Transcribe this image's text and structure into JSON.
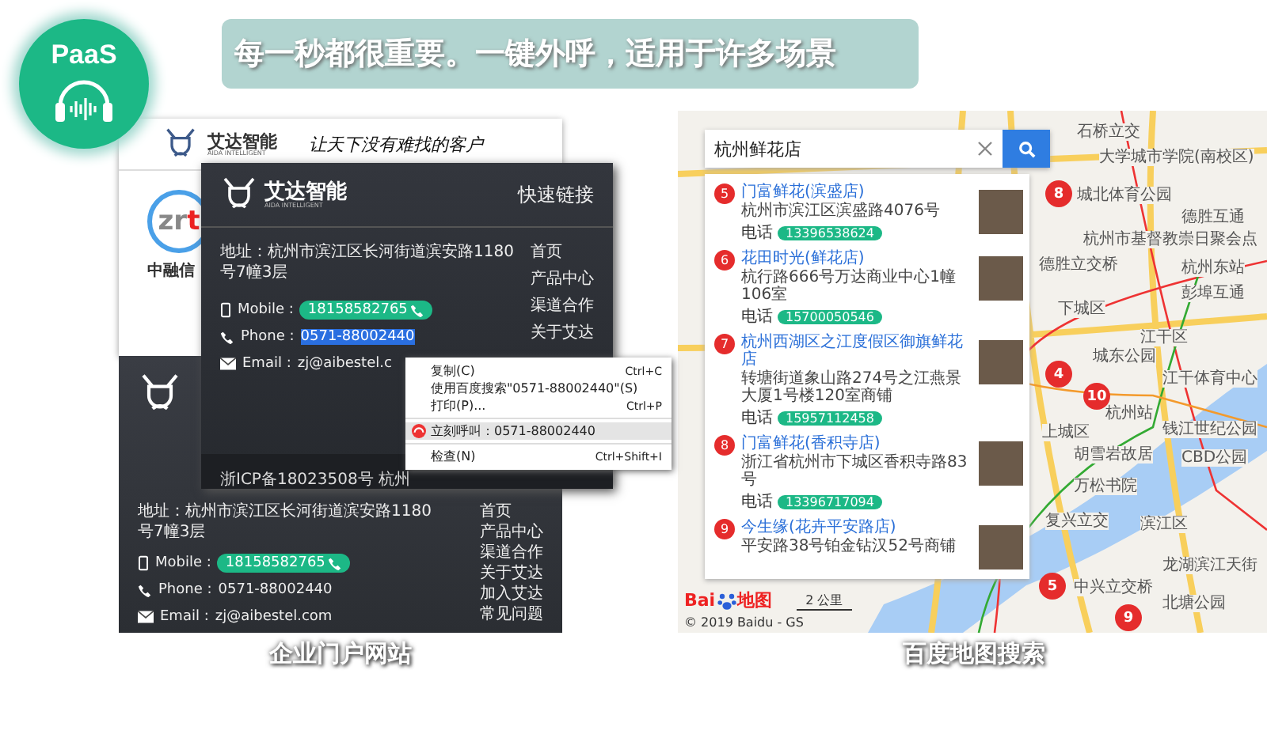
{
  "badge": {
    "label": "PaaS"
  },
  "headline": "每一秒都很重要。一键外呼，适用于许多场景",
  "portal": {
    "caption": "企业门户网站",
    "header": {
      "brand": "艾达智能",
      "brand_sub": "AIDA INTELLIGENT",
      "slogan": "让天下没有难找的客户"
    },
    "partner": {
      "logo_main": "zr",
      "logo_accent": "t",
      "name": "中融信"
    },
    "back_footer": {
      "address": "地址：杭州市滨江区长河街道滨安路1180号7幢3层",
      "mobile_label": "Mobile :",
      "mobile": "18158582765",
      "phone_label": "Phone :",
      "phone": "0571-88002440",
      "email_label": "Email :",
      "email": "zj@aibestel.com",
      "links": [
        "首页",
        "产品中心",
        "渠道合作",
        "关于艾达",
        "加入艾达",
        "常见问题"
      ]
    },
    "front_footer": {
      "brand": "艾达智能",
      "brand_sub": "AIDA INTELLIGENT",
      "links_title": "快速链接",
      "address": "地址：杭州市滨江区长河街道滨安路1180号7幢3层",
      "mobile_label": "Mobile :",
      "mobile": "18158582765",
      "phone_label": "Phone :",
      "phone": "0571-88002440",
      "phone_selected": true,
      "email_label": "Email :",
      "email": "zj@aibestel.c",
      "icp": "浙ICP备18023508号 杭州",
      "links": [
        "首页",
        "产品中心",
        "渠道合作",
        "关于艾达"
      ]
    },
    "context_menu": {
      "items": [
        {
          "kind": "plain",
          "label": "复制(C)",
          "shortcut": "Ctrl+C",
          "separator_above": false,
          "selected": false
        },
        {
          "kind": "plain",
          "label": "使用百度搜索\"0571-88002440\"(S)",
          "separator_above": false,
          "selected": false
        },
        {
          "kind": "plain",
          "label": "打印(P)...",
          "shortcut": "Ctrl+P",
          "separator_above": false,
          "selected": false
        },
        {
          "kind": "call",
          "label": "立刻呼叫：0571-88002440",
          "separator_above": true,
          "selected": true
        },
        {
          "kind": "plain",
          "label": "检查(N)",
          "shortcut": "Ctrl+Shift+I",
          "separator_above": true,
          "selected": false
        }
      ]
    }
  },
  "map": {
    "caption": "百度地图搜索",
    "search": {
      "value": "杭州鲜花店"
    },
    "results": [
      {
        "number": "5",
        "name": "门富鲜花(滨盛店)",
        "address": "杭州市滨江区滨盛路4076号",
        "phone_label": "电话",
        "phone": "13396538624"
      },
      {
        "number": "6",
        "name": "花田时光(鲜花店)",
        "address": "杭行路666号万达商业中心1幢106室",
        "phone_label": "电话",
        "phone": "15700050546"
      },
      {
        "number": "7",
        "name": "杭州西湖区之江度假区御旗鲜花店",
        "address": "转塘街道象山路274号之江燕景大厦1号楼120室商铺",
        "phone_label": "电话",
        "phone": "15957112458"
      },
      {
        "number": "8",
        "name": "门富鲜花(香积寺店)",
        "address": "浙江省杭州市下城区香积寺路83号",
        "phone_label": "电话",
        "phone": "13396717094"
      },
      {
        "number": "9",
        "name": "今生缘(花卉平安路店)",
        "address": "平安路38号铂金钻汉52号商铺"
      }
    ],
    "labels": [
      "石桥立交",
      "大学城市学院(南校区)",
      "城北体育公园",
      "德胜互通",
      "杭州市基督教崇日聚会点",
      "德胜立交桥",
      "杭州东站",
      "彭埠互通",
      "下城区",
      "城东公园",
      "江干区",
      "江干体育中心",
      "上城区",
      "杭州站",
      "钱江世纪公园",
      "胡雪岩故居",
      "CBD公园",
      "万松书院",
      "复兴立交",
      "滨江区",
      "龙湖滨江天街",
      "中兴立交桥",
      "北塘公园"
    ],
    "pins": [
      "8",
      "4",
      "10",
      "5",
      "9"
    ],
    "scale": "2 公里",
    "copyright": "© 2019 Baidu - GS",
    "logo_main": "Bai",
    "logo_sub": "地图"
  }
}
